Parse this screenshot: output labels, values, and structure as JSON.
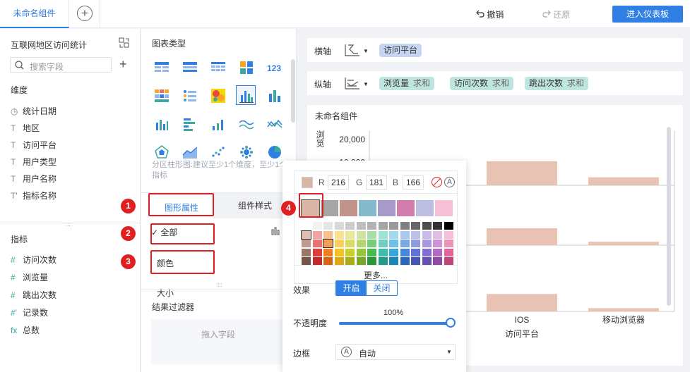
{
  "topbar": {
    "tab_label": "未命名组件",
    "add_tab_symbol": "+",
    "undo_label": "撤销",
    "redo_label": "还原",
    "enter_dashboard_label": "进入仪表板"
  },
  "left": {
    "dataset_title": "互联网地区访问统计",
    "search_placeholder": "搜索字段",
    "add_symbol": "+",
    "dimension_title": "维度",
    "dimensions": [
      {
        "icon": "clock-icon",
        "glyph": "◷",
        "label": "统计日期"
      },
      {
        "icon": "text-icon",
        "glyph": "T",
        "label": "地区"
      },
      {
        "icon": "text-icon",
        "glyph": "T",
        "label": "访问平台"
      },
      {
        "icon": "text-icon",
        "glyph": "T",
        "label": "用户类型"
      },
      {
        "icon": "text-icon",
        "glyph": "T",
        "label": "用户名称"
      },
      {
        "icon": "text-calc-icon",
        "glyph": "T'",
        "label": "指标名称"
      }
    ],
    "metric_title": "指标",
    "metrics": [
      {
        "icon": "hash-icon",
        "glyph": "#",
        "label": "访问次数"
      },
      {
        "icon": "hash-icon",
        "glyph": "#",
        "label": "浏览量"
      },
      {
        "icon": "hash-icon",
        "glyph": "#",
        "label": "跳出次数"
      },
      {
        "icon": "hash-calc-icon",
        "glyph": "#'",
        "label": "记录数"
      },
      {
        "icon": "function-icon",
        "glyph": "fx",
        "label": "总数"
      }
    ]
  },
  "middle": {
    "chart_type_title": "图表类型",
    "chart_type_hint": "分区柱形图:建议至少1个维度，至少1个指标",
    "tab_graph_props": "图形属性",
    "tab_component_style": "组件样式",
    "row_all": "全部",
    "row_all_icon": "bar-chart-icon",
    "row_color": "颜色",
    "row_size": "大小",
    "filter_title": "结果过滤器",
    "filter_drop_text": "拖入字段"
  },
  "annotations": [
    "1",
    "2",
    "3",
    "4"
  ],
  "axes": {
    "x_label": "横轴",
    "y_label": "纵轴",
    "x_pills": [
      {
        "label": "访问平台"
      }
    ],
    "y_pills": [
      {
        "label": "浏览量",
        "agg": "求和"
      },
      {
        "label": "访问次数",
        "agg": "求和"
      },
      {
        "label": "跳出次数",
        "agg": "求和"
      }
    ]
  },
  "chart_card": {
    "title": "未命名组件"
  },
  "chart_data": {
    "type": "bar",
    "categories": [
      "",
      "IOS",
      "移动浏览器"
    ],
    "xlabel": "访问平台",
    "ylabel": "浏览",
    "y_tick_labels": [
      "20,000",
      "10,000"
    ],
    "bar_color": "#e8c3b4",
    "series": [
      {
        "values": [
          8500,
          10500,
          3500
        ]
      },
      {
        "values": [
          null,
          7500,
          1500
        ]
      },
      {
        "values": [
          null,
          7000,
          1300
        ]
      }
    ]
  },
  "color_picker": {
    "current_color": "#d8b5a6",
    "r_label": "R",
    "r_value": "216",
    "g_label": "G",
    "g_value": "181",
    "b_label": "B",
    "b_value": "166",
    "auto_glyph": "A",
    "theme_colors": [
      "#d8b5a6",
      "#a6a6a6",
      "#c0948a",
      "#85b9cc",
      "#a79ac8",
      "#d17eae",
      "#bdbfe2",
      "#f6bfd3"
    ],
    "grays": [
      "#ffffff",
      "#f2f2f2",
      "#e6e6e6",
      "#d9d9d9",
      "#cccccc",
      "#bfbfbf",
      "#b3b3b3",
      "#a6a6a6",
      "#999999",
      "#808080",
      "#666666",
      "#4d4d4d",
      "#333333",
      "#000000"
    ],
    "palette_rows": [
      [
        "#e0bfb3",
        "#f4a2a2",
        "#f8c08e",
        "#fbe192",
        "#e6e99a",
        "#cde5a0",
        "#a7dfa7",
        "#9fe2d8",
        "#a4d8ee",
        "#a8c8ee",
        "#b8c2ea",
        "#c8bdea",
        "#e1bde5",
        "#f5bfd6"
      ],
      [
        "#c09a8c",
        "#ec7070",
        "#f49f58",
        "#f8d05a",
        "#d8dc66",
        "#b3d66e",
        "#77cc79",
        "#6fd0c2",
        "#6dc0e6",
        "#77a9e6",
        "#8e9be0",
        "#a697e0",
        "#cc93d6",
        "#ee93b8"
      ],
      [
        "#9c7666",
        "#e03c3c",
        "#ef7f1f",
        "#f5c21f",
        "#c8ce2c",
        "#96c639",
        "#48b94b",
        "#3fbdab",
        "#35a7dd",
        "#4487dd",
        "#5f73d4",
        "#8170d4",
        "#b468c6",
        "#e3649a"
      ],
      [
        "#785447",
        "#c4282a",
        "#d56512",
        "#dda812",
        "#a9ae14",
        "#78a72a",
        "#2e963a",
        "#239a89",
        "#1c85b8",
        "#2b67b8",
        "#4656b0",
        "#6451b0",
        "#9249a4",
        "#c0467a"
      ]
    ],
    "more_label": "更多...",
    "effect_label": "效果",
    "effect_on": "开启",
    "effect_off": "关闭",
    "opacity_label": "不透明度",
    "opacity_value": "100%",
    "opacity_fraction": 1.0,
    "border_label": "边框",
    "border_value": "自动"
  }
}
